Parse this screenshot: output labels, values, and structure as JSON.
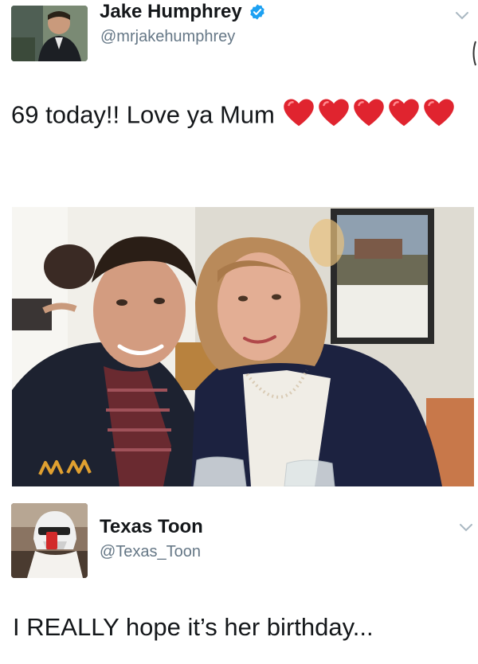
{
  "tweet1": {
    "author_name": "Jake Humphrey",
    "author_handle": "@mrjakehumphrey",
    "verified": true,
    "text": "69 today!! Love ya Mum",
    "hearts": 5,
    "photo_caption_scrawl": "MM"
  },
  "tweet2": {
    "author_name": "Texas Toon",
    "author_handle": "@Texas_Toon",
    "text": "I REALLY hope it’s her birthday..."
  },
  "colors": {
    "verified": "#1da1f2",
    "heart": "#e0242f",
    "handle": "#657786",
    "chevron": "#aab8c2"
  }
}
